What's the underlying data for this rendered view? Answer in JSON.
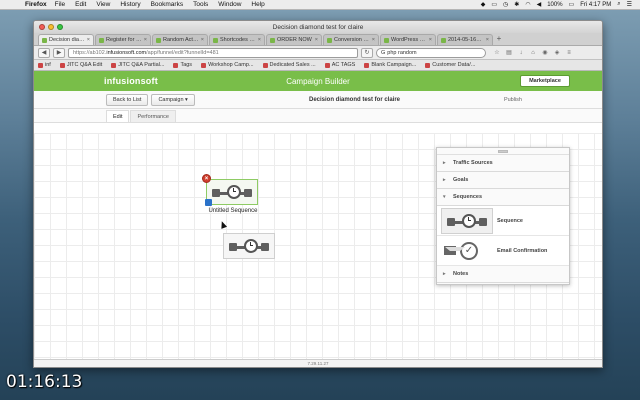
{
  "menubar": {
    "apple": "",
    "app": "Firefox",
    "items": [
      "File",
      "Edit",
      "View",
      "History",
      "Bookmarks",
      "Tools",
      "Window",
      "Help"
    ],
    "battery": "100%",
    "clock": "Fri 4:17 PM"
  },
  "window": {
    "title": "Decision diamond test for claire"
  },
  "tabs": [
    {
      "label": "Decision diam..."
    },
    {
      "label": "Register for th..."
    },
    {
      "label": "Random Action..."
    },
    {
      "label": "Shortcodes – ..."
    },
    {
      "label": "ORDER NOW"
    },
    {
      "label": "Conversion Fu..."
    },
    {
      "label": "WordPress › Lit..."
    },
    {
      "label": "2014-05-16_2..."
    }
  ],
  "nav": {
    "url_prefix": "https://ab102.",
    "url_host": "infusionsoft.com",
    "url_path": "/app/funnel/edit?funnelId=481",
    "search_value": "php random"
  },
  "bookmarks": [
    "inf",
    "JITC Q&A Edit",
    "JITC Q&A Partial...",
    "Tags",
    "Workshop Camp...",
    "Dedicated Sales ...",
    "AC TAGS",
    "Blank Campaign...",
    "Customer Data/..."
  ],
  "app": {
    "logo": "infusionsoft",
    "title": "Campaign Builder",
    "marketplace": "Marketplace",
    "back_button": "Back to List",
    "campaign_button": "Campaign ▾",
    "campaign_name": "Decision diamond test for claire",
    "publish": "Publish",
    "tabs": [
      "Edit",
      "Performance"
    ],
    "version": "7.29.11.27"
  },
  "canvas": {
    "sequence_label": "Untitled Sequence"
  },
  "panel": {
    "sections": [
      "Traffic Sources",
      "Goals",
      "Sequences",
      "Notes"
    ],
    "sequence_item": "Sequence",
    "email_item": "Email Confirmation"
  },
  "overlay": {
    "timestamp": "01:16:13"
  }
}
